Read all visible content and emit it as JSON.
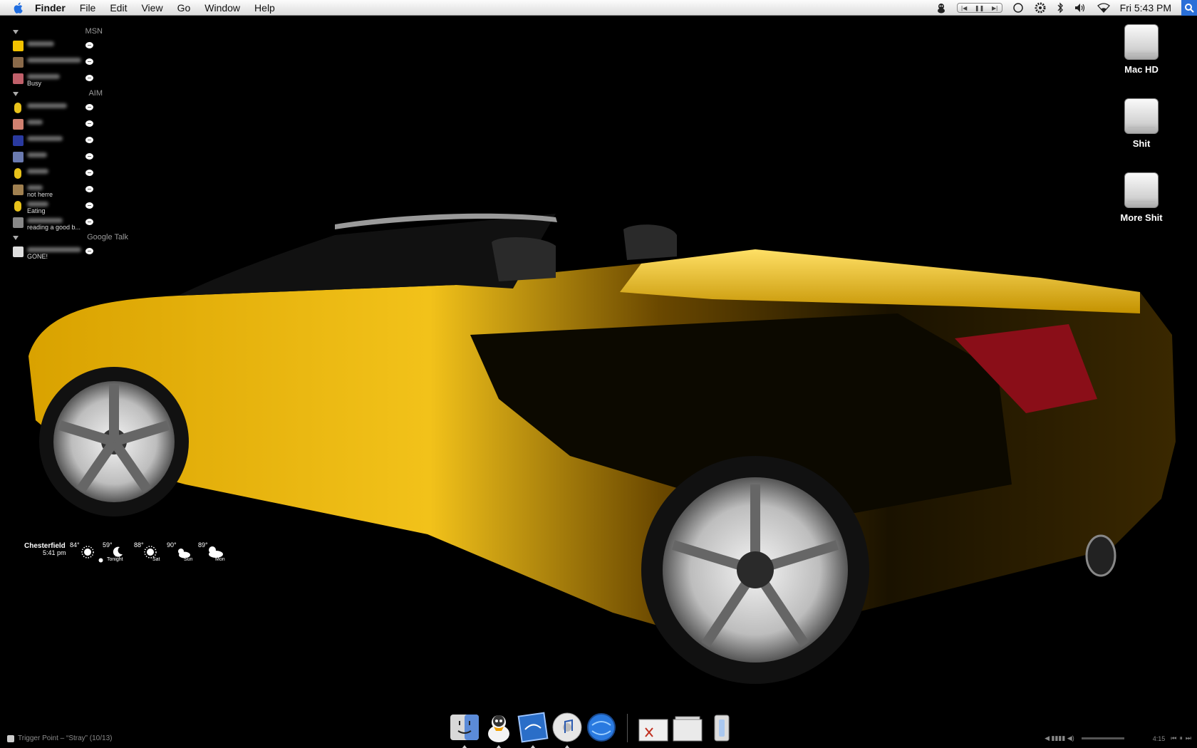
{
  "menubar": {
    "app_name": "Finder",
    "menus": [
      "File",
      "Edit",
      "View",
      "Go",
      "Window",
      "Help"
    ],
    "clock": "Fri 5:43 PM",
    "status_icons": [
      "adium-duck-icon",
      "itunes-controls",
      "sync-icon",
      "gear-icon",
      "bluetooth-icon",
      "volume-icon",
      "wifi-icon",
      "spotlight-icon"
    ]
  },
  "buddy_list": {
    "groups": [
      {
        "name": "MSN",
        "buddies": [
          {
            "status": "",
            "avatar_color": "#f2c200"
          },
          {
            "status": "",
            "avatar_color": "#8a6a4a"
          },
          {
            "status": "Busy",
            "avatar_color": "#c0606a"
          }
        ]
      },
      {
        "name": "AIM",
        "buddies": [
          {
            "status": "",
            "avatar_color": "#e8c21a"
          },
          {
            "status": "",
            "avatar_color": "#d08070"
          },
          {
            "status": "",
            "avatar_color": "#2a3aa0"
          },
          {
            "status": "",
            "avatar_color": "#6a7ab0"
          },
          {
            "status": "",
            "avatar_color": "#e8c21a"
          },
          {
            "status": "not herre",
            "avatar_color": "#a08050"
          },
          {
            "status": "Eating",
            "avatar_color": "#e8c21a"
          },
          {
            "status": "reading a good b...",
            "avatar_color": "#888888"
          }
        ]
      },
      {
        "name": "Google Talk",
        "buddies": [
          {
            "status": "GONE!",
            "avatar_color": "#dddddd"
          }
        ]
      }
    ]
  },
  "desktop_icons": [
    {
      "label": "Mac HD",
      "icon": "hard-drive-icon"
    },
    {
      "label": "Shit",
      "icon": "hard-drive-icon"
    },
    {
      "label": "More Shit",
      "icon": "usb-drive-icon"
    }
  ],
  "weather": {
    "city": "Chesterfield",
    "current_temp": "84°",
    "time": "5:41 pm",
    "forecast": [
      {
        "temp": "59°",
        "day": "Tonight",
        "icon": "moon-icon"
      },
      {
        "temp": "88°",
        "day": "Sat",
        "icon": "sun-icon"
      },
      {
        "temp": "90°",
        "day": "Sun",
        "icon": "partly-cloudy-icon"
      },
      {
        "temp": "89°",
        "day": "Mon",
        "icon": "partly-cloudy-icon"
      }
    ]
  },
  "dock": {
    "apps": [
      "finder-icon",
      "adium-icon",
      "mail-icon",
      "itunes-icon",
      "browser-icon"
    ],
    "others": [
      "document-icon",
      "folder-stack-icon",
      "trash-icon"
    ]
  },
  "now_playing": "Trigger Point – “Stray” (10/13)",
  "player_time": "4:15",
  "colors": {
    "car_yellow": "#e8b400",
    "desktop_bg": "#000000",
    "menubar_bg": "#efefef"
  }
}
